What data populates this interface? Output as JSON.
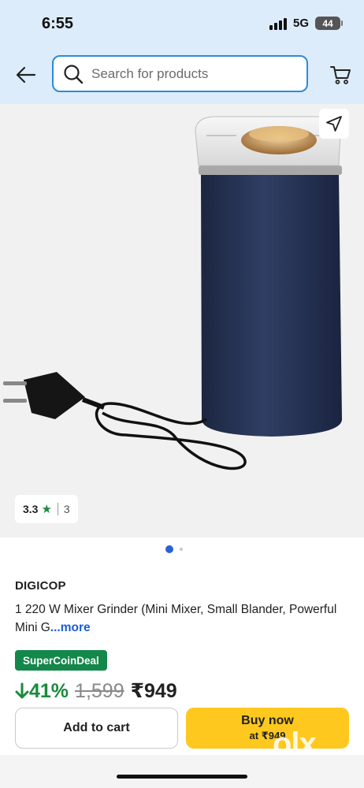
{
  "status_bar": {
    "time": "6:55",
    "network": "5G",
    "battery": "44"
  },
  "search": {
    "placeholder": "Search for products"
  },
  "product": {
    "rating": "3.3",
    "rating_star": "★",
    "rating_count": "3",
    "brand": "DIGICOP",
    "title": "1 220 W Mixer Grinder (Mini Mixer, Small Blander, Powerful Mini G",
    "more": "...more",
    "deal_badge": "SuperCoinDeal",
    "discount": "41%",
    "mrp": "1,599",
    "price": "₹949"
  },
  "actions": {
    "add_to_cart": "Add to cart",
    "buy_now": "Buy now",
    "buy_now_sub": "at ₹949"
  },
  "watermark": "olx",
  "colors": {
    "header_bg": "#dcecfb",
    "accent_blue": "#2c8bd8",
    "green": "#1b8a3b",
    "buy_yellow": "#ffc81e"
  },
  "icons": {
    "back": "arrow-left-icon",
    "search": "search-icon",
    "cart": "cart-icon",
    "share": "share-icon"
  },
  "carousel": {
    "total": 2,
    "active": 1
  }
}
